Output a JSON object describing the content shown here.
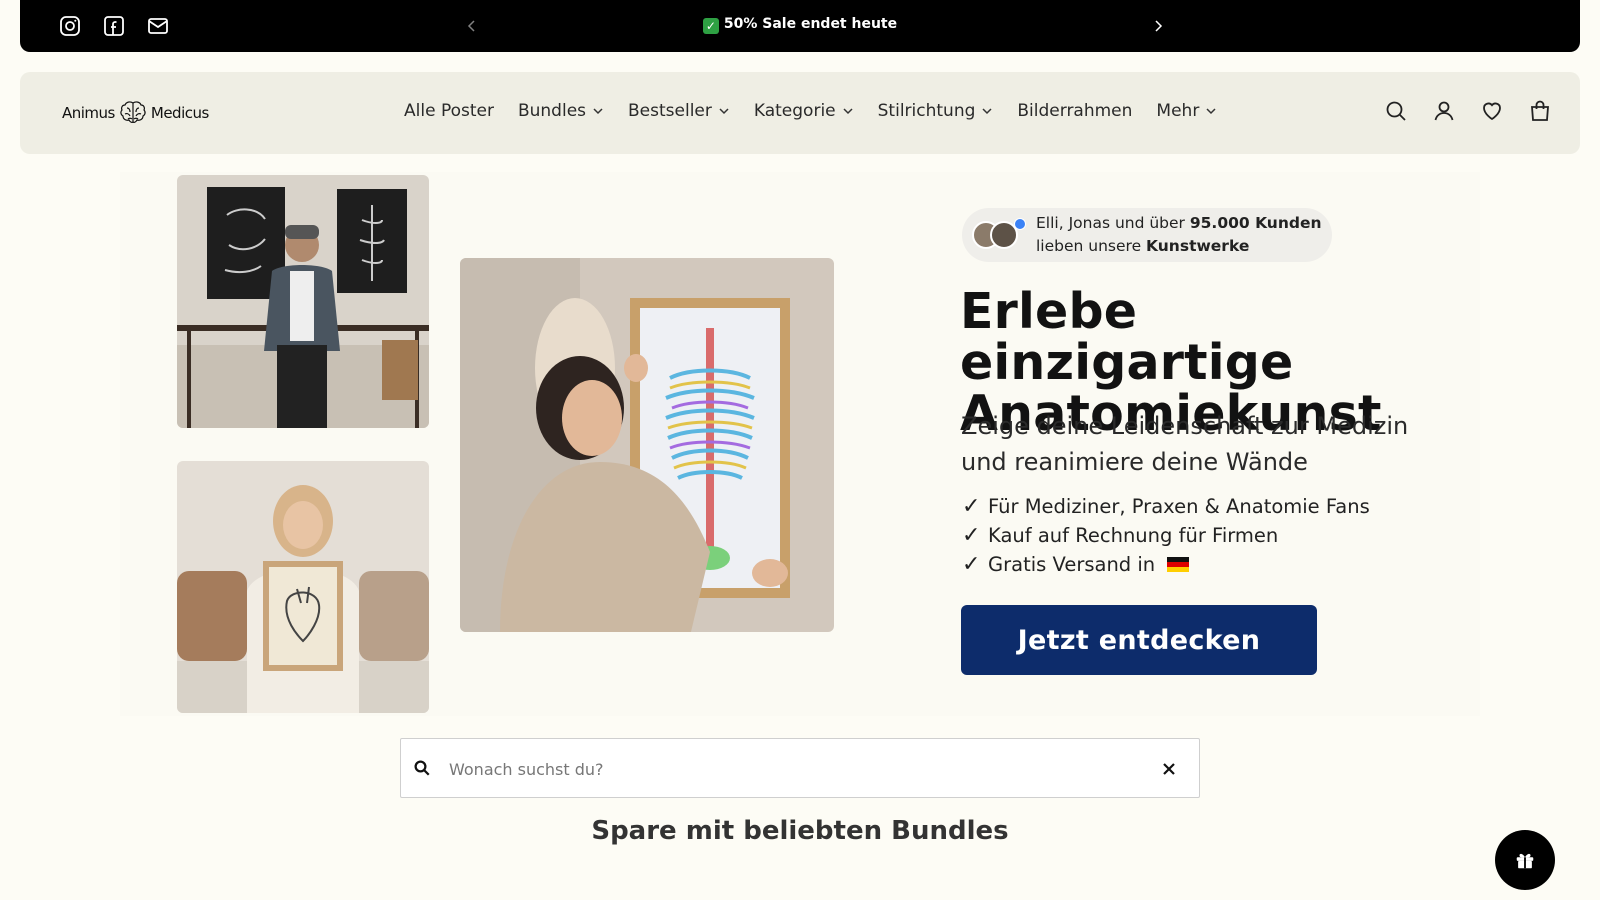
{
  "announcement": {
    "message": "50% Sale endet heute",
    "socials": [
      "instagram-icon",
      "facebook-icon",
      "mail-icon"
    ]
  },
  "header": {
    "logo_left": "Animus",
    "logo_right": "Medicus",
    "nav": [
      {
        "label": "Alle Poster",
        "dropdown": false
      },
      {
        "label": "Bundles",
        "dropdown": true
      },
      {
        "label": "Bestseller",
        "dropdown": true
      },
      {
        "label": "Kategorie",
        "dropdown": true
      },
      {
        "label": "Stilrichtung",
        "dropdown": true
      },
      {
        "label": "Bilderrahmen",
        "dropdown": false
      },
      {
        "label": "Mehr",
        "dropdown": true
      }
    ],
    "icons": [
      "search-icon",
      "account-icon",
      "wishlist-icon",
      "cart-icon"
    ]
  },
  "hero": {
    "social_proof": {
      "line1_prefix": "Elli, Jonas und über ",
      "line1_bold": "95.000 Kunden",
      "line2_prefix": "lieben unsere ",
      "line2_bold": "Kunstwerke"
    },
    "headline_line1": "Erlebe einzigartige",
    "headline_line2": "Anatomiekunst",
    "subheadline_line1": "Zeige deine Leidenschaft zur Medizin",
    "subheadline_line2": "und reanimiere deine Wände",
    "bullets": [
      "Für Mediziner, Praxen & Anatomie Fans",
      "Kauf auf Rechnung für Firmen",
      "Gratis Versand in"
    ],
    "cta_label": "Jetzt entdecken"
  },
  "search": {
    "placeholder": "Wonach suchst du?",
    "value": ""
  },
  "section": {
    "title": "Spare mit beliebten Bundles"
  },
  "colors": {
    "background": "#fdfcf5",
    "header_bg": "#efeee4",
    "cta": "#0d2c6b",
    "announcement_bg": "#000000"
  }
}
